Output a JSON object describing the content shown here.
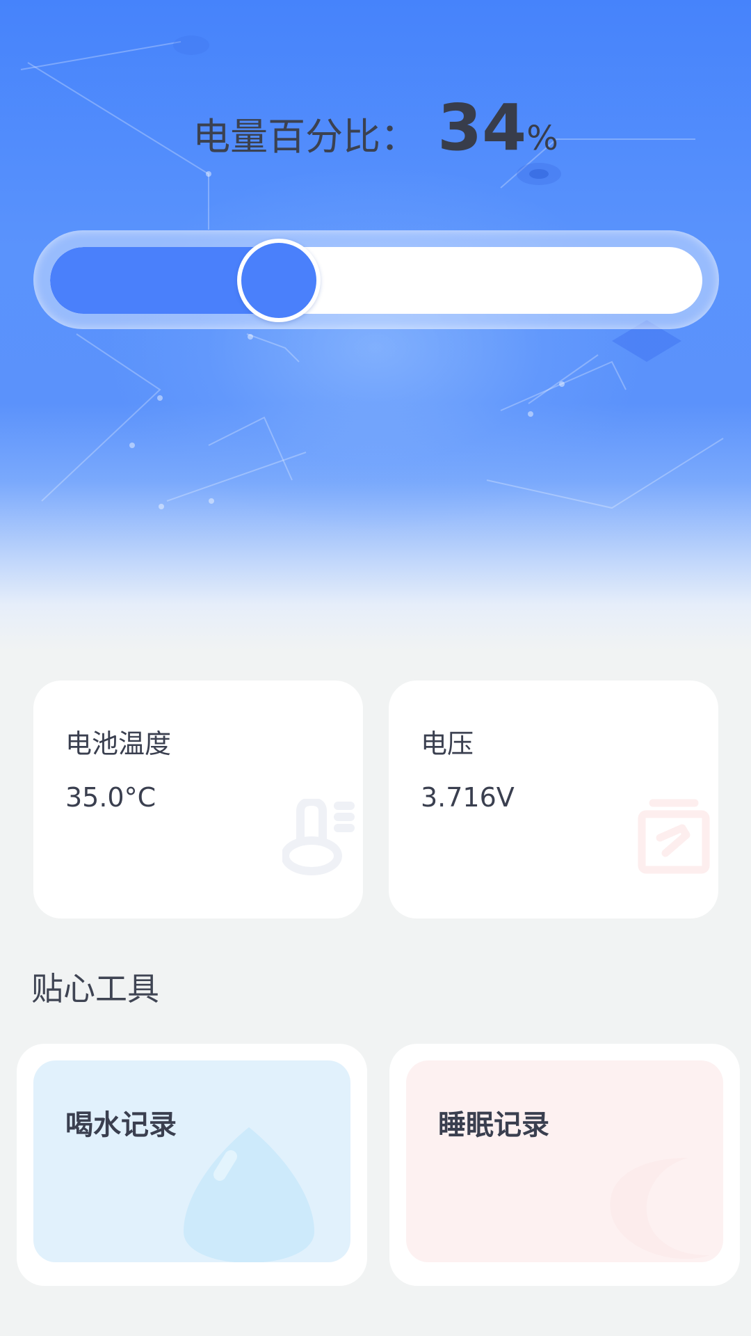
{
  "battery": {
    "label": "电量百分比：",
    "value": "34",
    "unit": "%",
    "level": 0.34
  },
  "stats": [
    {
      "title": "电池温度",
      "value": "35.0°C",
      "icon": "thermometer-icon"
    },
    {
      "title": "电压",
      "value": "3.716V",
      "icon": "battery-voltage-icon"
    }
  ],
  "tools": {
    "section_title": "贴心工具",
    "items": [
      {
        "label": "喝水记录",
        "icon": "water-drop-icon"
      },
      {
        "label": "睡眠记录",
        "icon": "moon-icon"
      }
    ]
  },
  "colors": {
    "accent": "#4a80fb",
    "hero_top": "#4683fb",
    "page_bg": "#f1f3f3",
    "text": "#3a3f4f",
    "water_card_bg": "#e1f1fc",
    "sleep_card_bg": "#fdf1f1"
  }
}
